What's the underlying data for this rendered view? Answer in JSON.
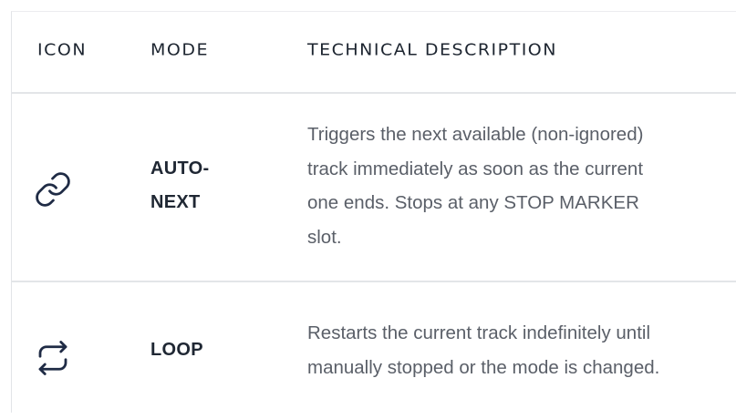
{
  "table": {
    "headers": {
      "icon": "ICON",
      "mode": "MODE",
      "description": "TECHNICAL DESCRIPTION"
    },
    "rows": [
      {
        "icon": "link-icon",
        "mode_lines": [
          "AUTO-",
          "NEXT"
        ],
        "description_lines": [
          "Triggers the next available (non-ignored)",
          "track immediately as soon as the current",
          "one ends. Stops at any STOP MARKER",
          "slot."
        ]
      },
      {
        "icon": "repeat-icon",
        "mode_lines": [
          "LOOP"
        ],
        "description_lines": [
          "Restarts the current track indefinitely until",
          "manually stopped or the mode is changed."
        ]
      }
    ]
  },
  "colors": {
    "icon_stroke": "#1f2b45",
    "text_dark": "#1f2733",
    "text_muted": "#5a5f68",
    "divider": "#e3e5e8"
  }
}
